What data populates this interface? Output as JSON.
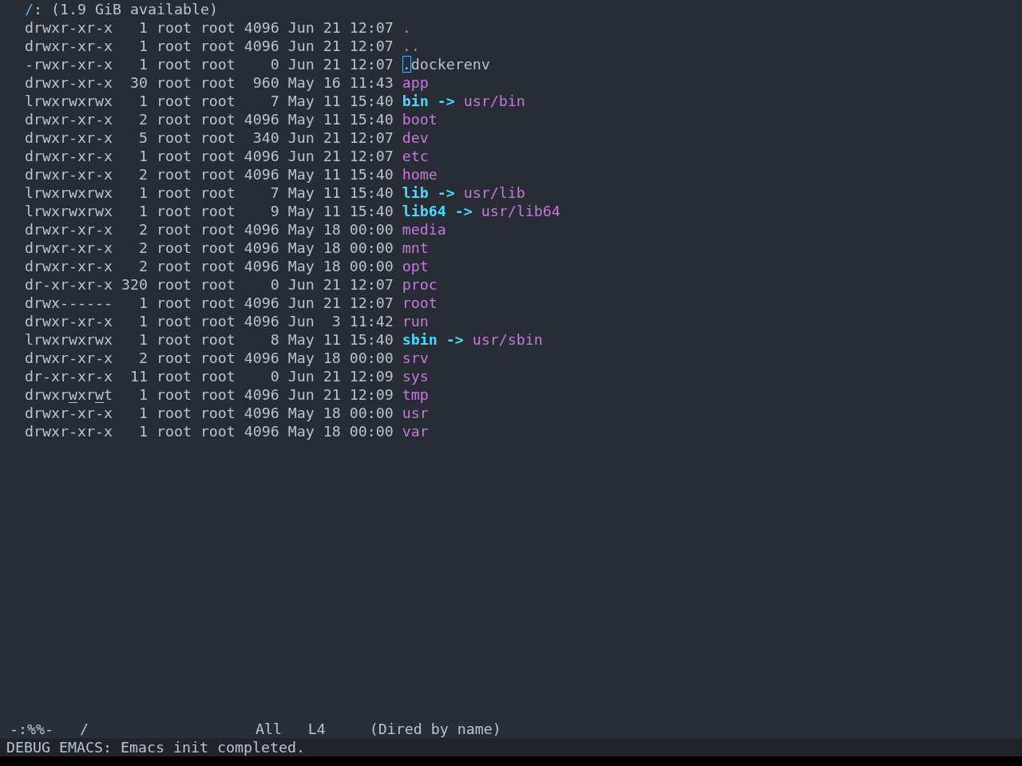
{
  "header": {
    "path": "/",
    "suffix": ":",
    "free_space": "(1.9 GiB available)"
  },
  "entries": [
    {
      "kind": "dir",
      "permissions": "drwxr-xr-x",
      "links": "1",
      "owner": "root",
      "group": "root",
      "size": "4096",
      "month": "Jun",
      "day": "21",
      "time": "12:07",
      "name": ".",
      "cursor": false,
      "world_writable": false
    },
    {
      "kind": "dir",
      "permissions": "drwxr-xr-x",
      "links": "1",
      "owner": "root",
      "group": "root",
      "size": "4096",
      "month": "Jun",
      "day": "21",
      "time": "12:07",
      "name": "..",
      "cursor": false,
      "world_writable": false
    },
    {
      "kind": "file",
      "permissions": "-rwxr-xr-x",
      "links": "1",
      "owner": "root",
      "group": "root",
      "size": "0",
      "month": "Jun",
      "day": "21",
      "time": "12:07",
      "name": ".dockerenv",
      "cursor": true,
      "world_writable": false
    },
    {
      "kind": "dir",
      "permissions": "drwxr-xr-x",
      "links": "30",
      "owner": "root",
      "group": "root",
      "size": "960",
      "month": "May",
      "day": "16",
      "time": "11:43",
      "name": "app",
      "cursor": false,
      "world_writable": false
    },
    {
      "kind": "symlink",
      "permissions": "lrwxrwxrwx",
      "links": "1",
      "owner": "root",
      "group": "root",
      "size": "7",
      "month": "May",
      "day": "11",
      "time": "15:40",
      "name": "bin",
      "arrow": "->",
      "target": "usr/bin",
      "cursor": false,
      "world_writable": false
    },
    {
      "kind": "dir",
      "permissions": "drwxr-xr-x",
      "links": "2",
      "owner": "root",
      "group": "root",
      "size": "4096",
      "month": "May",
      "day": "11",
      "time": "15:40",
      "name": "boot",
      "cursor": false,
      "world_writable": false
    },
    {
      "kind": "dir",
      "permissions": "drwxr-xr-x",
      "links": "5",
      "owner": "root",
      "group": "root",
      "size": "340",
      "month": "Jun",
      "day": "21",
      "time": "12:07",
      "name": "dev",
      "cursor": false,
      "world_writable": false
    },
    {
      "kind": "dir",
      "permissions": "drwxr-xr-x",
      "links": "1",
      "owner": "root",
      "group": "root",
      "size": "4096",
      "month": "Jun",
      "day": "21",
      "time": "12:07",
      "name": "etc",
      "cursor": false,
      "world_writable": false
    },
    {
      "kind": "dir",
      "permissions": "drwxr-xr-x",
      "links": "2",
      "owner": "root",
      "group": "root",
      "size": "4096",
      "month": "May",
      "day": "11",
      "time": "15:40",
      "name": "home",
      "cursor": false,
      "world_writable": false
    },
    {
      "kind": "symlink",
      "permissions": "lrwxrwxrwx",
      "links": "1",
      "owner": "root",
      "group": "root",
      "size": "7",
      "month": "May",
      "day": "11",
      "time": "15:40",
      "name": "lib",
      "arrow": "->",
      "target": "usr/lib",
      "cursor": false,
      "world_writable": false
    },
    {
      "kind": "symlink",
      "permissions": "lrwxrwxrwx",
      "links": "1",
      "owner": "root",
      "group": "root",
      "size": "9",
      "month": "May",
      "day": "11",
      "time": "15:40",
      "name": "lib64",
      "arrow": "->",
      "target": "usr/lib64",
      "cursor": false,
      "world_writable": false
    },
    {
      "kind": "dir",
      "permissions": "drwxr-xr-x",
      "links": "2",
      "owner": "root",
      "group": "root",
      "size": "4096",
      "month": "May",
      "day": "18",
      "time": "00:00",
      "name": "media",
      "cursor": false,
      "world_writable": false
    },
    {
      "kind": "dir",
      "permissions": "drwxr-xr-x",
      "links": "2",
      "owner": "root",
      "group": "root",
      "size": "4096",
      "month": "May",
      "day": "18",
      "time": "00:00",
      "name": "mnt",
      "cursor": false,
      "world_writable": false
    },
    {
      "kind": "dir",
      "permissions": "drwxr-xr-x",
      "links": "2",
      "owner": "root",
      "group": "root",
      "size": "4096",
      "month": "May",
      "day": "18",
      "time": "00:00",
      "name": "opt",
      "cursor": false,
      "world_writable": false
    },
    {
      "kind": "dir",
      "permissions": "dr-xr-xr-x",
      "links": "320",
      "owner": "root",
      "group": "root",
      "size": "0",
      "month": "Jun",
      "day": "21",
      "time": "12:07",
      "name": "proc",
      "cursor": false,
      "world_writable": false
    },
    {
      "kind": "dir",
      "permissions": "drwx------",
      "links": "1",
      "owner": "root",
      "group": "root",
      "size": "4096",
      "month": "Jun",
      "day": "21",
      "time": "12:07",
      "name": "root",
      "cursor": false,
      "world_writable": false
    },
    {
      "kind": "dir",
      "permissions": "drwxr-xr-x",
      "links": "1",
      "owner": "root",
      "group": "root",
      "size": "4096",
      "month": "Jun",
      "day": "3",
      "time": "11:42",
      "name": "run",
      "cursor": false,
      "world_writable": false
    },
    {
      "kind": "symlink",
      "permissions": "lrwxrwxrwx",
      "links": "1",
      "owner": "root",
      "group": "root",
      "size": "8",
      "month": "May",
      "day": "11",
      "time": "15:40",
      "name": "sbin",
      "arrow": "->",
      "target": "usr/sbin",
      "cursor": false,
      "world_writable": false
    },
    {
      "kind": "dir",
      "permissions": "drwxr-xr-x",
      "links": "2",
      "owner": "root",
      "group": "root",
      "size": "4096",
      "month": "May",
      "day": "18",
      "time": "00:00",
      "name": "srv",
      "cursor": false,
      "world_writable": false
    },
    {
      "kind": "dir",
      "permissions": "dr-xr-xr-x",
      "links": "11",
      "owner": "root",
      "group": "root",
      "size": "0",
      "month": "Jun",
      "day": "21",
      "time": "12:09",
      "name": "sys",
      "cursor": false,
      "world_writable": false
    },
    {
      "kind": "dir",
      "permissions": "drwxrwxrwt",
      "links": "1",
      "owner": "root",
      "group": "root",
      "size": "4096",
      "month": "Jun",
      "day": "21",
      "time": "12:09",
      "name": "tmp",
      "cursor": false,
      "world_writable": true
    },
    {
      "kind": "dir",
      "permissions": "drwxr-xr-x",
      "links": "1",
      "owner": "root",
      "group": "root",
      "size": "4096",
      "month": "May",
      "day": "18",
      "time": "00:00",
      "name": "usr",
      "cursor": false,
      "world_writable": false
    },
    {
      "kind": "dir",
      "permissions": "drwxr-xr-x",
      "links": "1",
      "owner": "root",
      "group": "root",
      "size": "4096",
      "month": "May",
      "day": "18",
      "time": "00:00",
      "name": "var",
      "cursor": false,
      "world_writable": false
    }
  ],
  "mode_line": {
    "status": "-:%%-",
    "buffer": "/",
    "position": "All",
    "line": "L4",
    "mode": "(Dired by name)"
  },
  "echo_area": {
    "message": "DEBUG EMACS: Emacs init completed."
  }
}
